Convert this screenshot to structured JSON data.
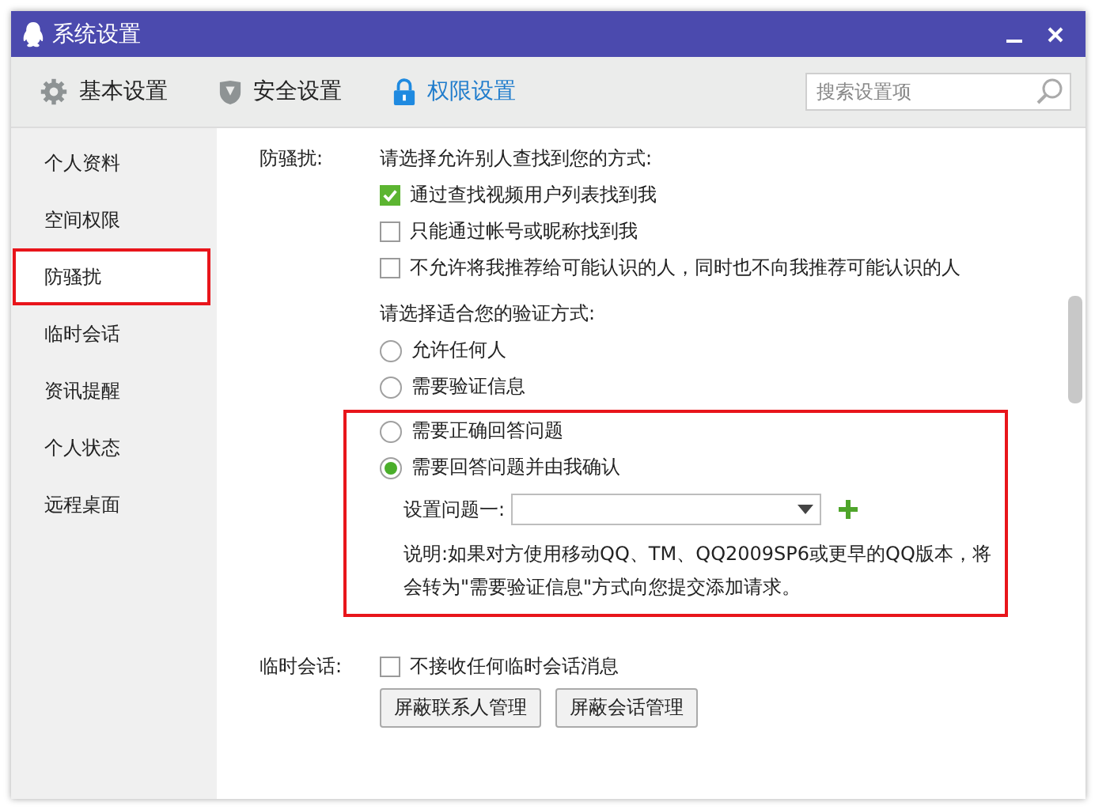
{
  "window": {
    "title": "系统设置"
  },
  "toolbar": {
    "tabs": [
      {
        "label": "基本设置",
        "kind": "gear",
        "selected": false
      },
      {
        "label": "安全设置",
        "kind": "shield",
        "selected": false
      },
      {
        "label": "权限设置",
        "kind": "lock",
        "selected": true
      }
    ],
    "search": {
      "placeholder": "搜索设置项"
    }
  },
  "sidebar": {
    "items": [
      {
        "label": "个人资料",
        "outlined": false
      },
      {
        "label": "空间权限",
        "outlined": false
      },
      {
        "label": "防骚扰",
        "outlined": true
      },
      {
        "label": "临时会话",
        "outlined": false
      },
      {
        "label": "资讯提醒",
        "outlined": false
      },
      {
        "label": "个人状态",
        "outlined": false
      },
      {
        "label": "远程桌面",
        "outlined": false
      }
    ]
  },
  "harassment": {
    "label": "防骚扰:",
    "find_prompt": "请选择允许别人查找到您的方式:",
    "find_options": [
      {
        "label": "通过查找视频用户列表找到我",
        "checked": true
      },
      {
        "label": "只能通过帐号或昵称找到我",
        "checked": false
      },
      {
        "label": "不允许将我推荐给可能认识的人，同时也不向我推荐可能认识的人",
        "checked": false
      }
    ],
    "verify_prompt": "请选择适合您的验证方式:",
    "verify_options": [
      {
        "label": "允许任何人",
        "selected": false
      },
      {
        "label": "需要验证信息",
        "selected": false
      },
      {
        "label": "需要正确回答问题",
        "selected": false,
        "outlined": true
      },
      {
        "label": "需要回答问题并由我确认",
        "selected": true,
        "outlined": true
      }
    ],
    "question_label": "设置问题一:",
    "note_lines": [
      "说明:如果对方使用移动QQ、TM、QQ2009SP6或更早的QQ版本，将",
      "会转为\"需要验证信息\"方式向您提交添加请求。"
    ]
  },
  "temp_chat": {
    "label": "临时会话:",
    "options": [
      {
        "label": "不接收任何临时会话消息",
        "checked": false
      }
    ],
    "buttons": [
      "屏蔽联系人管理",
      "屏蔽会话管理"
    ]
  }
}
